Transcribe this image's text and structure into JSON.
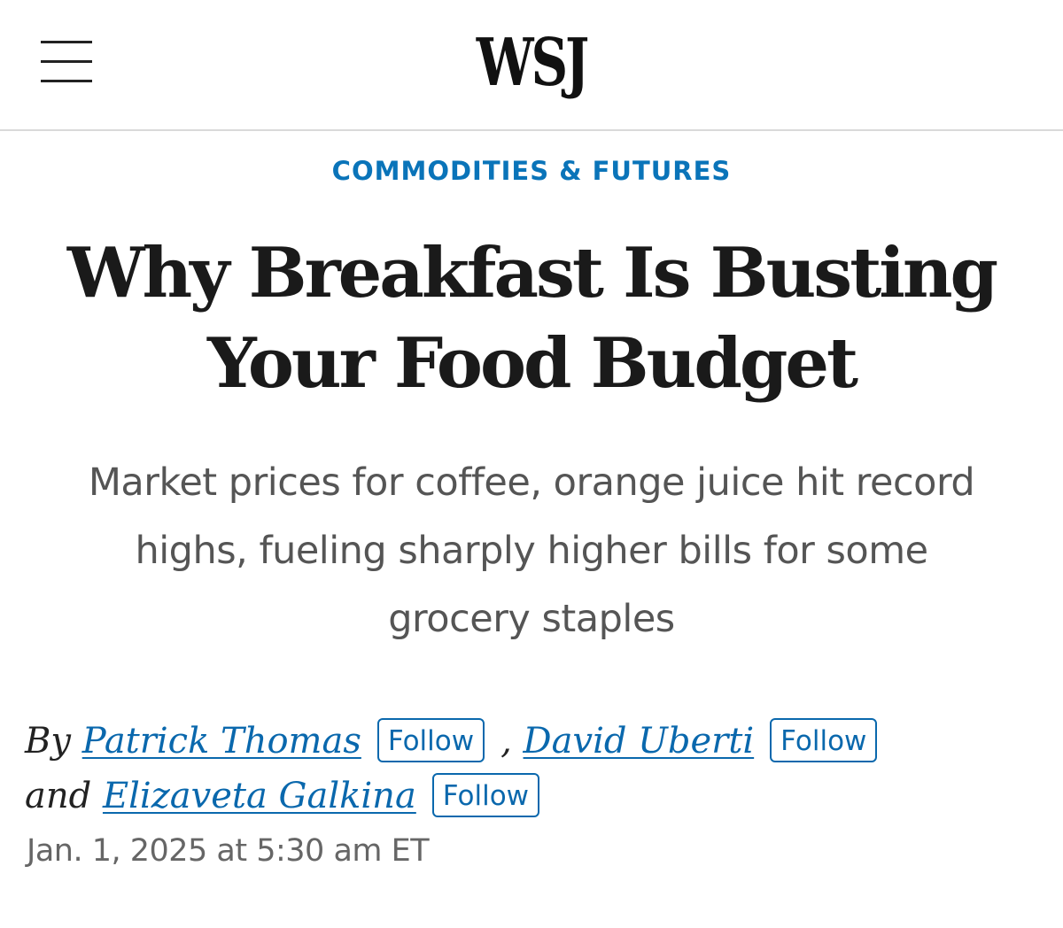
{
  "header": {
    "logo": "WSJ",
    "menu_icon": "hamburger-menu-icon"
  },
  "article": {
    "section": "COMMODITIES & FUTURES",
    "headline_line1": "Why Breakfast Is Busting",
    "headline_line2": "Your Food Budget",
    "dek_line1": "Market prices for coffee, orange juice hit record",
    "dek_line2": "highs, fueling sharply higher bills for some",
    "dek_line3": "grocery staples",
    "byline": {
      "by": "By",
      "comma": ",",
      "and": "and",
      "authors": [
        {
          "name": "Patrick Thomas",
          "follow_label": "Follow"
        },
        {
          "name": "David Uberti",
          "follow_label": "Follow"
        },
        {
          "name": "Elizaveta Galkina",
          "follow_label": "Follow"
        }
      ]
    },
    "timestamp": "Jan. 1, 2025 at 5:30 am ET"
  },
  "colors": {
    "accent": "#0a74b9",
    "link": "#0a68ad",
    "headline": "#1a1a1a",
    "dek": "#555555",
    "timestamp": "#666666",
    "divider": "#d9d9d9"
  }
}
